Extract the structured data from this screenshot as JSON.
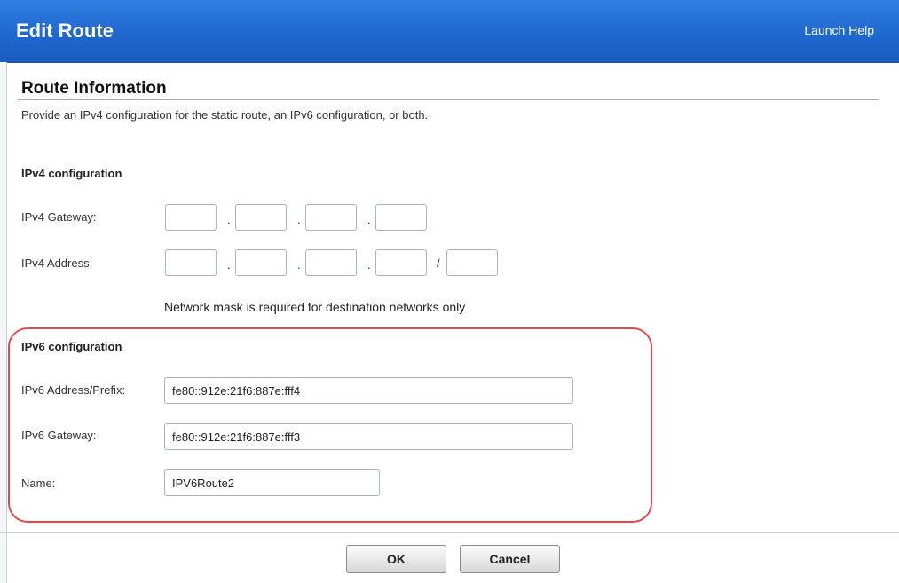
{
  "dialog": {
    "title": "Edit Route",
    "help_link": "Launch Help"
  },
  "route_info": {
    "heading": "Route Information",
    "description": "Provide an IPv4 configuration for the static route, an IPv6 configuration, or both."
  },
  "ipv4": {
    "heading": "IPv4 configuration",
    "gateway_label": "IPv4 Gateway:",
    "gateway_octets": [
      "",
      "",
      "",
      ""
    ],
    "address_label": "IPv4 Address:",
    "address_octets": [
      "",
      "",
      "",
      ""
    ],
    "mask_value": "",
    "dot_separator": ".",
    "mask_separator": "/",
    "mask_note": "Network mask is required for destination networks only"
  },
  "ipv6": {
    "heading": "IPv6 configuration",
    "address_label": "IPv6 Address/Prefix:",
    "address_value": "fe80::912e:21f6:887e:fff4",
    "gateway_label": "IPv6 Gateway:",
    "gateway_value": "fe80::912e:21f6:887e:fff3",
    "name_label": "Name:",
    "name_value": "IPV6Route2"
  },
  "buttons": {
    "ok": "OK",
    "cancel": "Cancel"
  },
  "colors": {
    "title_bar": "#1f68cf",
    "highlight_outline": "#e34a4a"
  }
}
